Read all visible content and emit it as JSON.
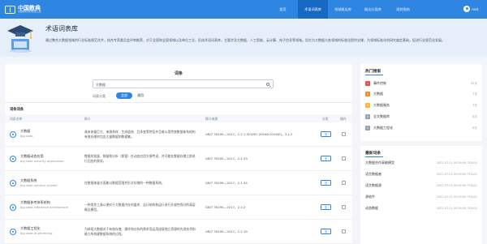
{
  "nav": {
    "logo_main": "中国教典",
    "logo_sub": "全国教育标准化信息工程",
    "menu": [
      "首页",
      "术语词表库",
      "领域概念库",
      "概念分类库",
      "规划指南"
    ],
    "active_index": 1,
    "user": "root"
  },
  "banner": {
    "title": "术语词表库",
    "desc": "通过整合大数据领域的行业标准规范文件，结合专家委员会评审推荐、对于全国和全国领域以及单位工业，形成术语词表库，主要涉及大数据、人工智能、云计算、电子信息等领域。旨在为大数据与各领域的标准化提供支撑，为领域标准化的研究奠定基础，促进行业规范化发展。"
  },
  "search": {
    "title": "词条",
    "value": "大数据",
    "filter_label": "词表分类",
    "chip_all": "全部",
    "chip_general": "通用"
  },
  "list": {
    "title": "词条词条",
    "headers": [
      "词条名称",
      "释义",
      "释义来源",
      "分类",
      "操作"
    ],
    "rows": [
      {
        "term": "大数据",
        "en": "big data",
        "def": "具有体量巨大、来源多样、生成极快、且多变等特征并且难以用传统数据体系结构有效处理的包含大量数据的数据集。",
        "src": "GB/T 35295—2017，2.2.1 ISO/IEC 20546:2019(E)，3.1.2",
        "tag": "无"
      },
      {
        "term": "大数据动态应用",
        "en": "big data velocity application",
        "def": "数据的批量、移量和分析（即管）在动态应用方便传送，并可能在数据存储之前进行回应的需求。",
        "src": "GB/T 35295—2017，2.2.33",
        "tag": "无"
      },
      {
        "term": "大数据系统",
        "en": "big data volume system",
        "def": "在数据体量方面能以数据范围并形式存储的一种数据系统。",
        "src": "GB/T 35295—2017，2.2.34",
        "tag": "无"
      },
      {
        "term": "大数据参考体系结构",
        "en": "big data reference architecture",
        "def": "一种用作工具以便对于大数据内在的要求、设计结构和运行进行开放性探讨的高层概念模型。",
        "src": "GB/T 35295—2017，2.2.2",
        "tag": "无"
      },
      {
        "term": "大数据工程化",
        "en": "big data engineering",
        "def": "为体现大数据对于有效存储、操作和分析的需求而运用连接独立资源的先进技术和能力所构建数据系统的过程。",
        "src": "GB/T 35295—2017，2.2.19",
        "tag": "无"
      }
    ]
  },
  "hot": {
    "title": "热门搜索",
    "items": [
      {
        "rank": "1",
        "label": "事件控制",
        "count": "52次",
        "color": "#e84a4a"
      },
      {
        "rank": "2",
        "label": "大数据",
        "count": "7次",
        "color": "#f08a24"
      },
      {
        "rank": "3",
        "label": "大数据服务",
        "count": "7次",
        "color": "#f5b82e"
      },
      {
        "rank": "4",
        "label": "全文数据库",
        "count": "6次",
        "color": "#8fa3b8"
      },
      {
        "rank": "5",
        "label": "大数据工程化",
        "count": "6次",
        "color": "#8fa3b8"
      }
    ]
  },
  "recent": {
    "title": "最新词条",
    "items": [
      {
        "label": "大数据合作高能模型",
        "date": "2022-07-01 09:29:09.753431"
      },
      {
        "label": "语言数据者",
        "date": "2022-07-01 09:29:09.753431"
      },
      {
        "label": "语言数据源",
        "date": "2022-07-01 09:29:09.753431"
      },
      {
        "label": "源软件",
        "date": "2022-07-01 09:29:09.753431"
      },
      {
        "label": "动态数据",
        "date": "2022-07-01 09:29:09.753431"
      }
    ]
  }
}
